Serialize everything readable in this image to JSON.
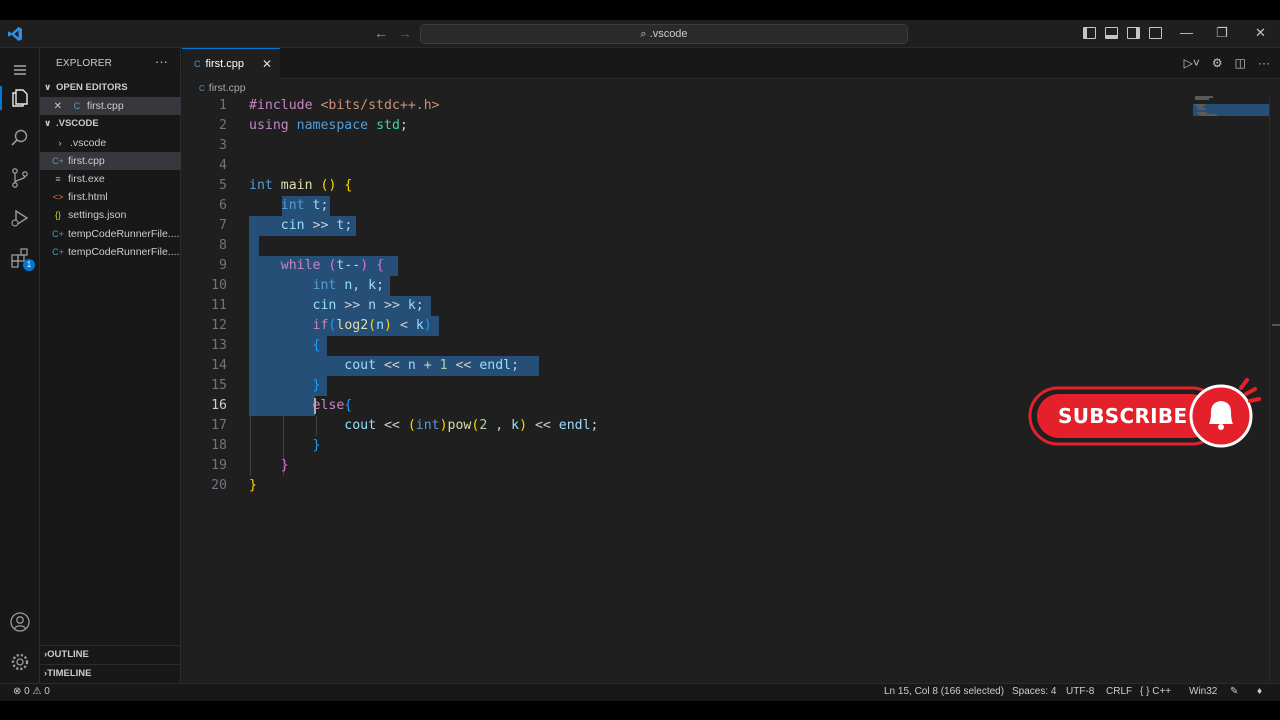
{
  "titlebar": {
    "search_text": "⌕ .vscode",
    "back_glyph": "←",
    "forward_glyph": "→",
    "minimize_glyph": "—",
    "restore_glyph": "❐",
    "close_glyph": "✕"
  },
  "sidebar": {
    "title": "EXPLORER",
    "more": "···",
    "open_editors_label": "OPEN EDITORS",
    "open_editors": [
      {
        "name": "first.cpp",
        "close": "✕"
      }
    ],
    "folder_label": ".VSCODE",
    "files": [
      {
        "name": ".vscode",
        "icon": "›"
      },
      {
        "name": "first.cpp",
        "icon": "C+"
      },
      {
        "name": "first.exe",
        "icon": "≡"
      },
      {
        "name": "first.html",
        "icon": "<>"
      },
      {
        "name": "settings.json",
        "icon": "{}"
      },
      {
        "name": "tempCodeRunnerFile....",
        "icon": "C+"
      },
      {
        "name": "tempCodeRunnerFile....",
        "icon": "C+"
      }
    ],
    "outline_label": "OUTLINE",
    "timeline_label": "TIMELINE"
  },
  "activity": {
    "extensions_badge": "1"
  },
  "editor": {
    "tab_label": "first.cpp",
    "tab_close": "✕",
    "breadcrumb": "first.cpp",
    "current_line": 16,
    "line_numbers": [
      "1",
      "2",
      "3",
      "4",
      "5",
      "6",
      "7",
      "8",
      "9",
      "10",
      "11",
      "12",
      "13",
      "14",
      "15",
      "16",
      "17",
      "18",
      "19",
      "20"
    ]
  },
  "overlay": {
    "subscribe_label": "SUBSCRIBE"
  },
  "status": {
    "problems": "⊗ 0 ⚠ 0",
    "position": "Ln 15, Col 8 (166 selected)",
    "spaces": "Spaces: 4",
    "encoding": "UTF-8",
    "eol": "CRLF",
    "language": "{ } C++",
    "platform": "Win32"
  },
  "colors": {
    "accent": "#0078d4",
    "selection": "#264f78",
    "subscribe_red": "#e4202a"
  }
}
